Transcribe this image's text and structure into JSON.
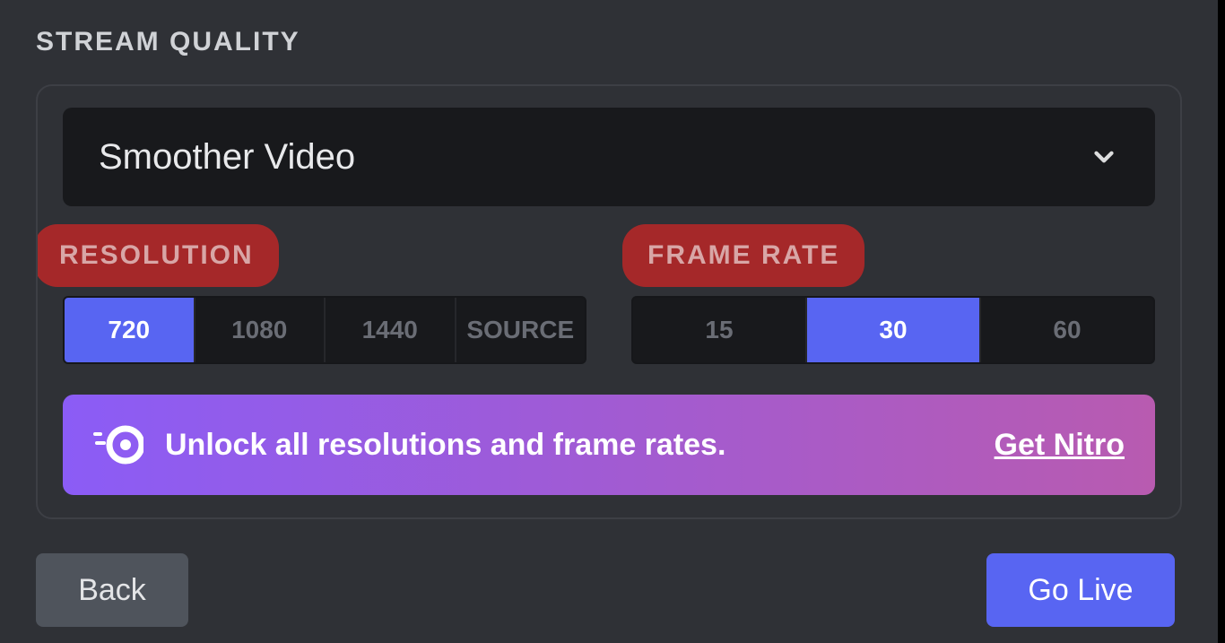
{
  "section_title": "STREAM QUALITY",
  "preset": {
    "selected": "Smoother Video"
  },
  "resolution": {
    "label": "RESOLUTION",
    "options": [
      "720",
      "1080",
      "1440",
      "SOURCE"
    ],
    "active_index": 0
  },
  "framerate": {
    "label": "FRAME RATE",
    "options": [
      "15",
      "30",
      "60"
    ],
    "active_index": 1
  },
  "nitro": {
    "text": "Unlock all resolutions and frame rates.",
    "cta": "Get Nitro"
  },
  "footer": {
    "back": "Back",
    "go_live": "Go Live"
  }
}
